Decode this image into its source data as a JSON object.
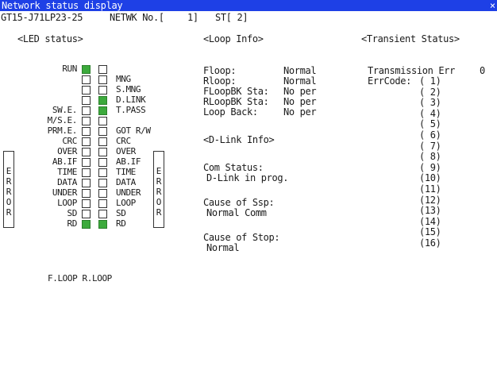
{
  "window": {
    "title": "Network status display",
    "close_glyph": "×"
  },
  "header": {
    "model": "GT15-J71LP23-25",
    "netwk_label": "NETWK No.[",
    "netwk_value": "1]",
    "station": "ST[ 2]"
  },
  "sections": {
    "led_status": "<LED status>",
    "loop_info": "<Loop Info>",
    "transient_status": "<Transient Status>",
    "dlink_info": "<D-Link Info>"
  },
  "led": {
    "left_labels": [
      "RUN",
      "",
      "",
      "",
      "SW.E.",
      "M/S.E.",
      "PRM.E.",
      "CRC",
      "OVER",
      "AB.IF",
      "TIME",
      "DATA",
      "UNDER",
      "LOOP",
      "SD",
      "RD"
    ],
    "right_labels": [
      "",
      "MNG",
      "S.MNG",
      "D.LINK",
      "T.PASS",
      "",
      "GOT R/W",
      "CRC",
      "OVER",
      "AB.IF",
      "TIME",
      "DATA",
      "UNDER",
      "LOOP",
      "SD",
      "RD"
    ],
    "left_on": [
      true,
      false,
      false,
      false,
      false,
      false,
      false,
      false,
      false,
      false,
      false,
      false,
      false,
      false,
      false,
      true
    ],
    "right_on": [
      false,
      false,
      false,
      true,
      true,
      false,
      false,
      false,
      false,
      false,
      false,
      false,
      false,
      false,
      false,
      true
    ],
    "error_letters": [
      "E",
      "R",
      "R",
      "O",
      "R"
    ],
    "footer": "F.LOOP R.LOOP",
    "on_color": "#3caa3c"
  },
  "loop_info": {
    "rows": [
      {
        "label": "Floop:",
        "value": "Normal"
      },
      {
        "label": "Rloop:",
        "value": "Normal"
      },
      {
        "label": "FLoopBK Sta:",
        "value": "No per"
      },
      {
        "label": "RLoopBK Sta:",
        "value": "No per"
      },
      {
        "label": "Loop Back:",
        "value": "No per"
      }
    ]
  },
  "dlink_info": {
    "com_status_label": "Com Status:",
    "com_status_value": "D-Link in prog.",
    "ssp_label": "Cause of Ssp:",
    "ssp_value": "Normal Comm",
    "stop_label": "Cause of Stop:",
    "stop_value": "Normal"
  },
  "transient": {
    "err_label": "Transmission Err",
    "err_value": "0",
    "errcode_label": "ErrCode:",
    "codes": [
      "( 1)",
      "( 2)",
      "( 3)",
      "( 4)",
      "( 5)",
      "( 6)",
      "( 7)",
      "( 8)",
      "( 9)",
      "(10)",
      "(11)",
      "(12)",
      "(13)",
      "(14)",
      "(15)",
      "(16)"
    ]
  },
  "colors": {
    "title_bar": "#1e40e6",
    "led_on": "#3caa3c"
  }
}
